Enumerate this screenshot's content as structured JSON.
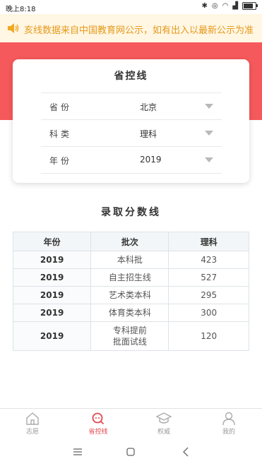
{
  "status": {
    "time": "晚上8:18"
  },
  "notice": {
    "text": "亥线数据来自中国教育网公示，如有出入以最新公示为准"
  },
  "filter_card": {
    "title": "省控线",
    "rows": [
      {
        "label": "省份",
        "value": "北京"
      },
      {
        "label": "科类",
        "value": "理科"
      },
      {
        "label": "年份",
        "value": "2019"
      }
    ]
  },
  "scores": {
    "title": "录取分数线",
    "headers": [
      "年份",
      "批次",
      "理科"
    ],
    "rows": [
      {
        "year": "2019",
        "batch": "本科批",
        "score": "423"
      },
      {
        "year": "2019",
        "batch": "自主招生线",
        "score": "527"
      },
      {
        "year": "2019",
        "batch": "艺术类本科",
        "score": "295"
      },
      {
        "year": "2019",
        "batch": "体育类本科",
        "score": "300"
      },
      {
        "year": "2019",
        "batch": "专科提前批面试线",
        "score": "120"
      }
    ]
  },
  "tabs": [
    {
      "label": "志愿",
      "icon": "home-icon",
      "active": false
    },
    {
      "label": "省控线",
      "icon": "search-icon",
      "active": true
    },
    {
      "label": "权威",
      "icon": "graduation-cap-icon",
      "active": false
    },
    {
      "label": "我的",
      "icon": "person-icon",
      "active": false
    }
  ],
  "colors": {
    "brand_red": "#f5595b",
    "tab_active": "#e2464a",
    "notice_text": "#e59a1b",
    "notice_bg": "#fff6e3"
  }
}
